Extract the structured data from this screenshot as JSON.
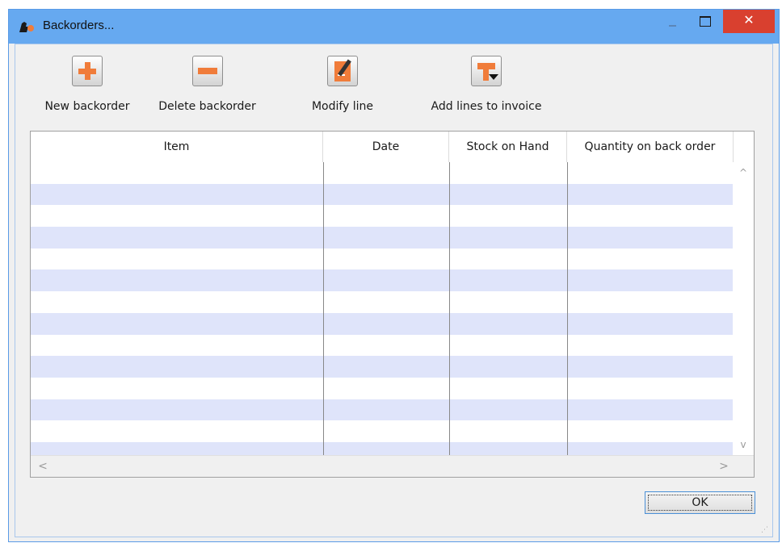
{
  "window": {
    "title": "Backorders...",
    "controls": {
      "minimize": "—",
      "maximize": "□",
      "close": "✕"
    }
  },
  "toolbar": {
    "new_label": "New backorder",
    "delete_label": "Delete backorder",
    "modify_label": "Modify line",
    "add_lines_label": "Add lines to invoice"
  },
  "table": {
    "columns": [
      "Item",
      "Date",
      "Stock on Hand",
      "Quantity on back order"
    ],
    "rows": []
  },
  "scroll": {
    "up": "^",
    "down": "v",
    "left": "<",
    "right": ">"
  },
  "footer": {
    "ok_label": "OK"
  },
  "colors": {
    "titlebar": "#66a9f0",
    "close": "#d9402f",
    "accent": "#f07c3a",
    "row_alt": "#dfe4fa"
  }
}
